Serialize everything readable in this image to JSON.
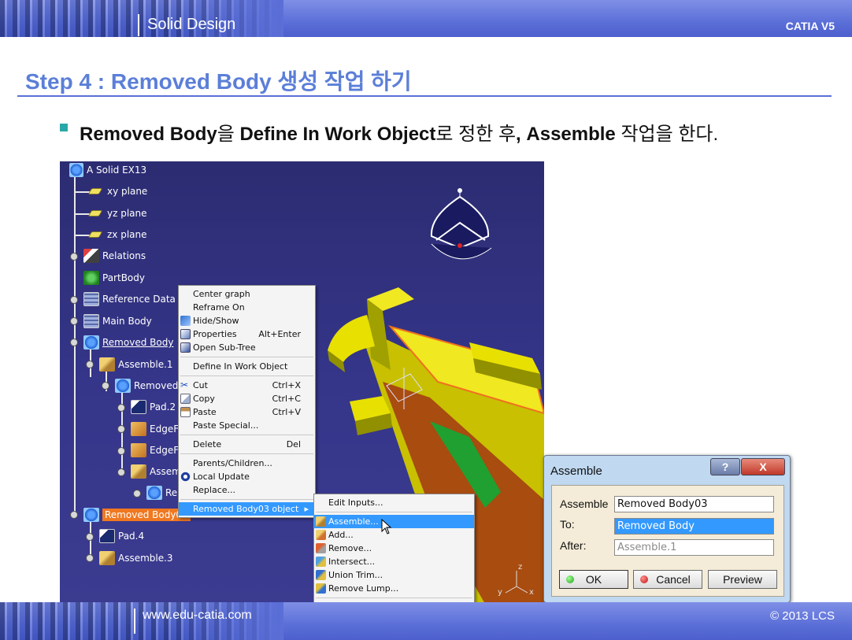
{
  "header": {
    "title": "Solid Design",
    "brand": "CATIA V5"
  },
  "footer": {
    "url": "www.edu-catia.com",
    "copyright": "© 2013 LCS"
  },
  "slide": {
    "step_title": "Step 4 : Removed Body 생성 작업 하기",
    "instruction": {
      "part1": "Removed Body",
      "part2": "을 ",
      "part3": "Define In Work Object",
      "part4": "로 정한 후",
      "part5": ", Assemble",
      "part6": " 작업을 한다."
    }
  },
  "tree": {
    "root": "A Solid EX13",
    "xy": "xy plane",
    "yz": "yz plane",
    "zx": "zx plane",
    "relations": "Relations",
    "partbody": "PartBody",
    "refdata": "Reference Data",
    "mainbody": "Main Body",
    "removedbody": "Removed Body",
    "assemble1": "Assemble.1",
    "removed": "Removed",
    "pad2": "Pad.2",
    "edgef1": "EdgeFi",
    "edgef2": "EdgeFi",
    "assem": "Assem",
    "re": "Re",
    "removedbody03": "Removed Body03",
    "pad4": "Pad.4",
    "assemble3": "Assemble.3"
  },
  "context_menu": {
    "center_graph": "Center graph",
    "reframe_on": "Reframe On",
    "hide_show": "Hide/Show",
    "properties": "Properties",
    "properties_sc": "Alt+Enter",
    "open_subtree": "Open Sub-Tree",
    "define_in_work": "Define In Work Object",
    "cut": "Cut",
    "cut_sc": "Ctrl+X",
    "copy": "Copy",
    "copy_sc": "Ctrl+C",
    "paste": "Paste",
    "paste_sc": "Ctrl+V",
    "paste_special": "Paste Special...",
    "delete": "Delete",
    "delete_sc": "Del",
    "parents_children": "Parents/Children...",
    "local_update": "Local Update",
    "replace": "Replace...",
    "object": "Removed Body03 object"
  },
  "submenu": {
    "edit_inputs": "Edit Inputs...",
    "assemble": "Assemble...",
    "add": "Add...",
    "remove": "Remove...",
    "intersect": "Intersect...",
    "union_trim": "Union Trim...",
    "remove_lump": "Remove Lump..."
  },
  "dialog": {
    "title": "Assemble",
    "help": "?",
    "close": "X",
    "assemble_label": "Assemble",
    "assemble_value": "Removed Body03",
    "to_label": "To:",
    "to_value": "Removed Body",
    "after_label": "After:",
    "after_value": "Assemble.1",
    "ok": "OK",
    "cancel": "Cancel",
    "preview": "Preview"
  },
  "compass": {
    "z": "z",
    "y": "y",
    "x": "x"
  }
}
